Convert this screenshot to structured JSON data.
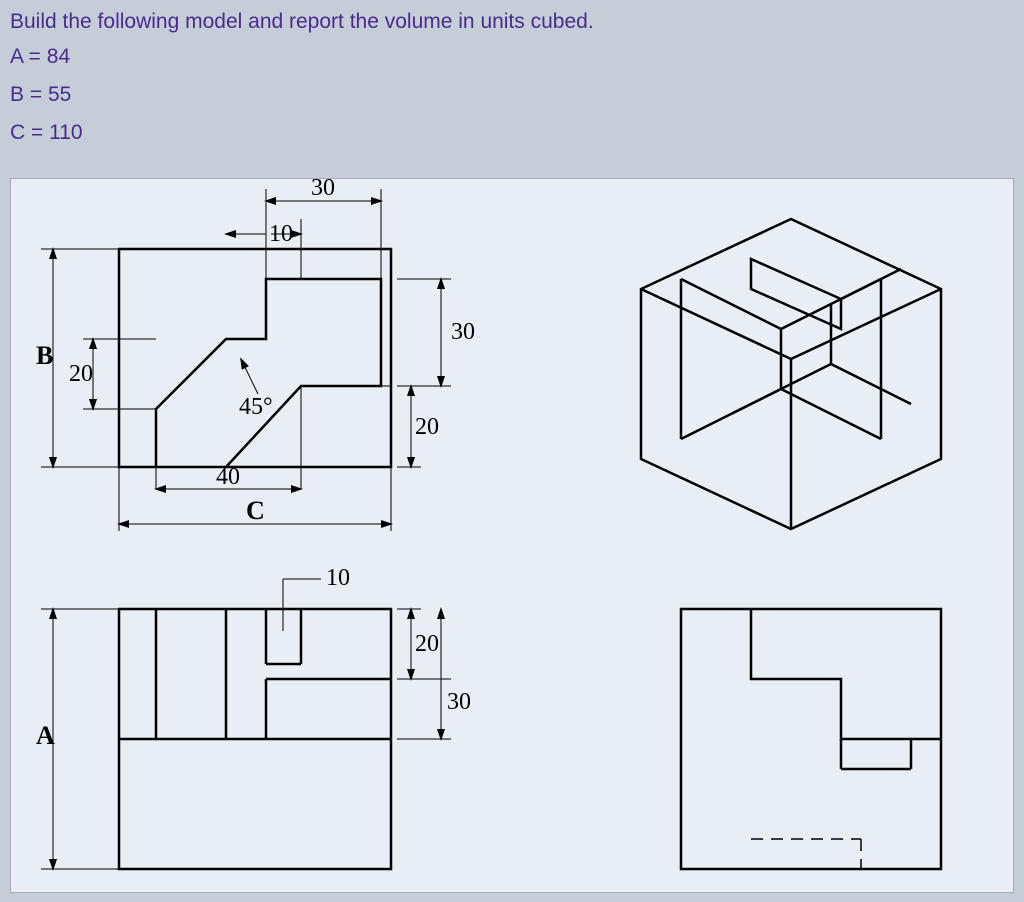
{
  "instruction": "Build the following model and report the volume in units cubed.",
  "parameters": {
    "A_label": "A = 84",
    "B_label": "B = 55",
    "C_label": "C = 110",
    "A": 84,
    "B": 55,
    "C": 110
  },
  "dimensions": {
    "top30": "30",
    "top10": "10",
    "B": "B",
    "left20": "20",
    "angle45": "45°",
    "right20": "20",
    "right30": "30",
    "bot40": "40",
    "C": "C",
    "mid10": "10",
    "A": "A",
    "lower20": "20",
    "lower30": "30"
  }
}
